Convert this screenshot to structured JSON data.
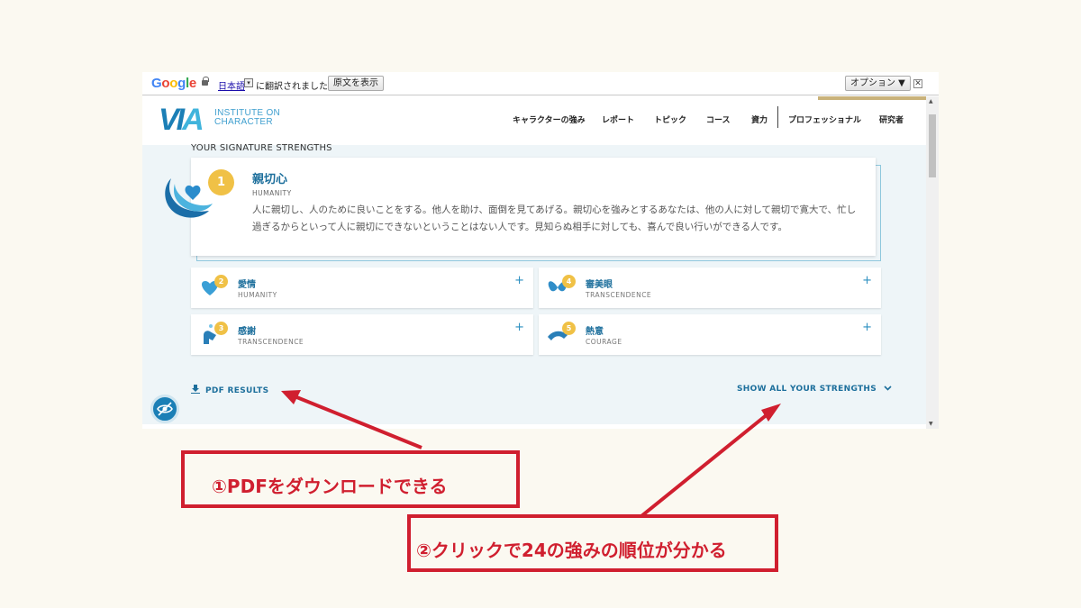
{
  "translate_bar": {
    "logo": "Google",
    "language": "日本語",
    "dropdown_glyph": "▾",
    "message": "に翻訳されました",
    "show_original": "原文を表示",
    "options": "オプション ▼",
    "close": "✕"
  },
  "header": {
    "logo_text": "VIA",
    "institute_line1": "INSTITUTE ON",
    "institute_line2": "CHARACTER",
    "nav": [
      "キャラクターの強み",
      "レポート",
      "トピック",
      "コース",
      "資力",
      "プロフェッショナル",
      "研究者"
    ]
  },
  "signature": {
    "title": "YOUR SIGNATURE STRENGTHS",
    "top": {
      "rank": "1",
      "name": "親切心",
      "category": "HUMANITY",
      "description": "人に親切し、人のために良いことをする。他人を助け、面倒を見てあげる。親切心を強みとするあなたは、他の人に対して親切で寛大で、忙し過ぎるからといって人に親切にできないということはない人です。見知らぬ相手に対しても、喜んで良い行いができる人です。"
    },
    "others": [
      {
        "rank": "2",
        "name": "愛情",
        "category": "HUMANITY",
        "plus": "+"
      },
      {
        "rank": "4",
        "name": "審美眼",
        "category": "TRANSCENDENCE",
        "plus": "+"
      },
      {
        "rank": "3",
        "name": "感謝",
        "category": "TRANSCENDENCE",
        "plus": "+"
      },
      {
        "rank": "5",
        "name": "熱意",
        "category": "COURAGE",
        "plus": "+"
      }
    ]
  },
  "actions": {
    "pdf": "PDF RESULTS",
    "show_all": "SHOW ALL YOUR STRENGTHS",
    "chevron": "⌄"
  },
  "annotations": {
    "callout1": "①PDFをダウンロードできる",
    "callout2": "②クリックで24の強みの順位が分かる"
  },
  "colors": {
    "brand_blue": "#1d6f9c",
    "badge_gold": "#f0c146",
    "annotation_red": "#d01f2f"
  }
}
